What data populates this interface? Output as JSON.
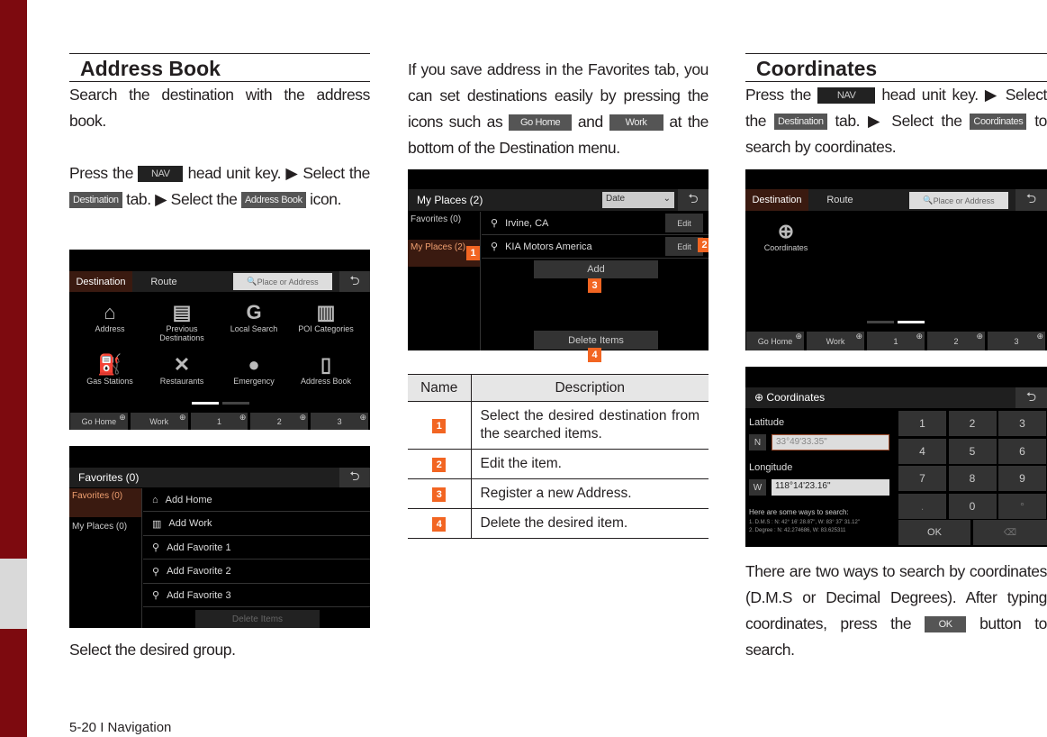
{
  "footer": "5-20 I Navigation",
  "address_book": {
    "heading": "Address Book",
    "intro": "Search the destination with the address book.",
    "step_press": "Press the",
    "nav_key": "NAV",
    "step_head": "head unit key. ▶ Select the",
    "destination_key": "Destination",
    "step_tab": "tab. ▶ Select the",
    "address_book_key": "Address Book",
    "step_icon": "icon.",
    "screen1": {
      "tabs": [
        "Destination",
        "Route"
      ],
      "search_placeholder": "Place or Address",
      "icons": [
        {
          "label": "Address",
          "icon": "house-search-icon"
        },
        {
          "label": "Previous Destinations",
          "icon": "folder-clock-icon"
        },
        {
          "label": "Local Search",
          "icon": "google-icon"
        },
        {
          "label": "POI Categories",
          "icon": "building-search-icon"
        },
        {
          "label": "Gas Stations",
          "icon": "gas-pump-icon"
        },
        {
          "label": "Restaurants",
          "icon": "fork-spoon-icon"
        },
        {
          "label": "Emergency",
          "icon": "siren-icon"
        },
        {
          "label": "Address Book",
          "icon": "book-pin-icon"
        }
      ],
      "favorites": [
        "Go Home",
        "Work",
        "1",
        "2",
        "3"
      ]
    },
    "screen2": {
      "title": "Favorites (0)",
      "side": [
        "Favorites (0)",
        "My Places (0)"
      ],
      "items": [
        "Add Home",
        "Add Work",
        "Add Favorite 1",
        "Add Favorite 2",
        "Add Favorite 3"
      ],
      "delete": "Delete Items"
    },
    "caption": "Select the desired group."
  },
  "favorites": {
    "text1": "If you save address in the Favorites tab, you can set destinations easily by pressing the icons such as",
    "go_home": "Go Home",
    "and": "and",
    "work": "Work",
    "text2": "at the bottom of the Destination menu.",
    "screen": {
      "title": "My Places (2)",
      "sort": "Date",
      "side": [
        "Favorites (0)",
        "My Places (2)"
      ],
      "items": [
        "Irvine, CA",
        "KIA Motors America"
      ],
      "edit": "Edit",
      "add": "Add",
      "delete": "Delete Items"
    },
    "table": {
      "headers": [
        "Name",
        "Description"
      ],
      "rows": [
        {
          "n": "1",
          "d": "Select the desired destination from the searched items."
        },
        {
          "n": "2",
          "d": "Edit the item."
        },
        {
          "n": "3",
          "d": "Register a new Address."
        },
        {
          "n": "4",
          "d": "Delete the desired item."
        }
      ]
    }
  },
  "coordinates": {
    "heading": "Coordinates",
    "step_press": "Press the",
    "nav_key": "NAV",
    "step_head": "head unit key. ▶ Select the",
    "destination_key": "Destination",
    "step_tab": "tab. ▶ Select the",
    "coord_key": "Coordinates",
    "step_end": "to search by coordinates.",
    "screen1": {
      "tabs": [
        "Destination",
        "Route"
      ],
      "search_placeholder": "Place or Address",
      "icon_label": "Coordinates",
      "favorites": [
        "Go Home",
        "Work",
        "1",
        "2",
        "3"
      ]
    },
    "screen2": {
      "title": "Coordinates",
      "lat_label": "Latitude",
      "lat_dir": "N",
      "lat_value": "33°49'33.35\"",
      "lon_label": "Longitude",
      "lon_dir": "W",
      "lon_value": "118°14'23.16\"",
      "hint": "Here are some ways to search:",
      "hint1": "1. D.M.S : N: 42° 16' 28.87\", W: 83° 37' 31.12\"",
      "hint2": "2. Degree : N: 42.274686, W: 83.625311",
      "keys": [
        "1",
        "2",
        "3",
        "4",
        "5",
        "6",
        "7",
        "8",
        "9",
        ".",
        "0",
        "°"
      ],
      "ok": "OK"
    },
    "text1": "There are two ways to search by coordinates (D.M.S or Decimal Degrees). After typing coordinates, press the",
    "ok_key": "OK",
    "text2": "button to search."
  }
}
